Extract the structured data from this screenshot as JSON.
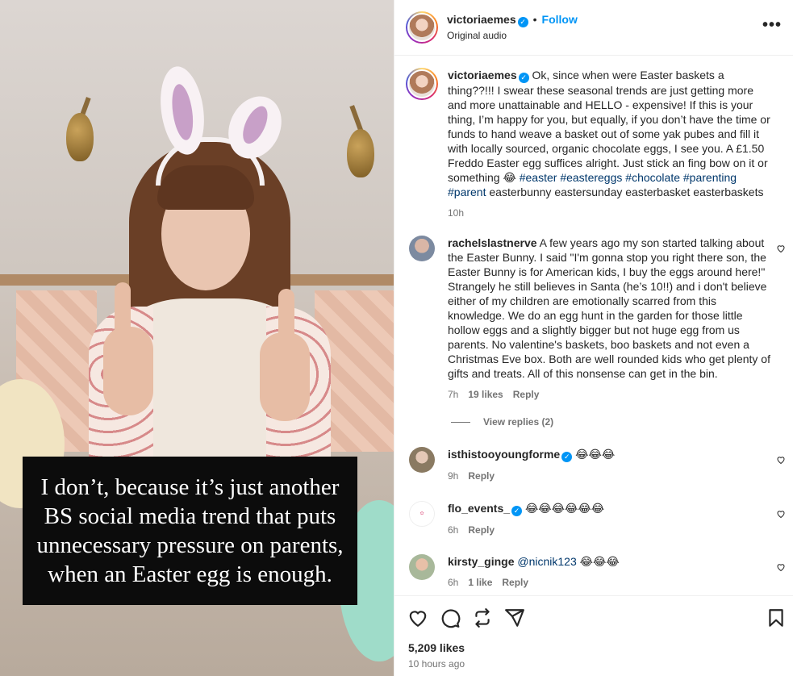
{
  "media": {
    "caption": "I don’t, because it’s just another BS social media trend that puts unnecessary pressure on parents, when an Easter egg is enough."
  },
  "header": {
    "username": "victoriaemes",
    "separator": "•",
    "follow_label": "Follow",
    "subtitle": "Original audio"
  },
  "post": {
    "username": "victoriaemes",
    "text": "Ok, since when were Easter baskets a thing??!!! I swear these seasonal trends are just getting more and more unattainable and HELLO - expensive! If this is your thing, I’m happy for you, but equally, if you don’t have the time or funds to hand weave a basket out of some yak pubes and fill it with locally sourced, organic chocolate eggs, I see you. A £1.50 Freddo Easter egg suffices alright. Just stick an fing bow on it or something 😂",
    "hashtags": [
      "#easter",
      "#eastereggs",
      "#chocolate",
      "#parenting",
      "#parent"
    ],
    "tail": "easterbunny eastersunday easterbasket easterbaskets",
    "time": "10h"
  },
  "comments": [
    {
      "username": "rachelslastnerve",
      "text": "A few years ago my son started talking about the Easter Bunny. I said \"I'm gonna stop you right there son, the Easter Bunny is for American kids, I buy the eggs around here!\" Strangely he still believes in Santa (he’s 10!!) and i don't believe either of my children are emotionally scarred from this knowledge. We do an egg hunt in the garden for those little hollow eggs and a slightly bigger but not huge egg from us parents. No valentine's baskets, boo baskets and not even a Christmas Eve box. Both are well rounded kids who get plenty of gifts and treats. All of this nonsense can get in the bin.",
      "time": "7h",
      "likes": "19 likes",
      "reply": "Reply",
      "view_replies": "View replies (2)"
    },
    {
      "username": "isthistooyoungforme",
      "text": "😂😂😂",
      "time": "9h",
      "reply": "Reply"
    },
    {
      "username": "flo_events_",
      "text": "😂😂😂😂😂😂",
      "time": "6h",
      "reply": "Reply"
    },
    {
      "username": "kirsty_ginge",
      "mention": "@nicnik123",
      "text": "😂😂😂",
      "time": "6h",
      "likes": "1 like",
      "reply": "Reply"
    }
  ],
  "footer": {
    "likes": "5,209 likes",
    "time": "10 hours ago"
  },
  "colors": {
    "link": "#0095f6",
    "hashtag": "#00376b",
    "muted": "#737373"
  }
}
